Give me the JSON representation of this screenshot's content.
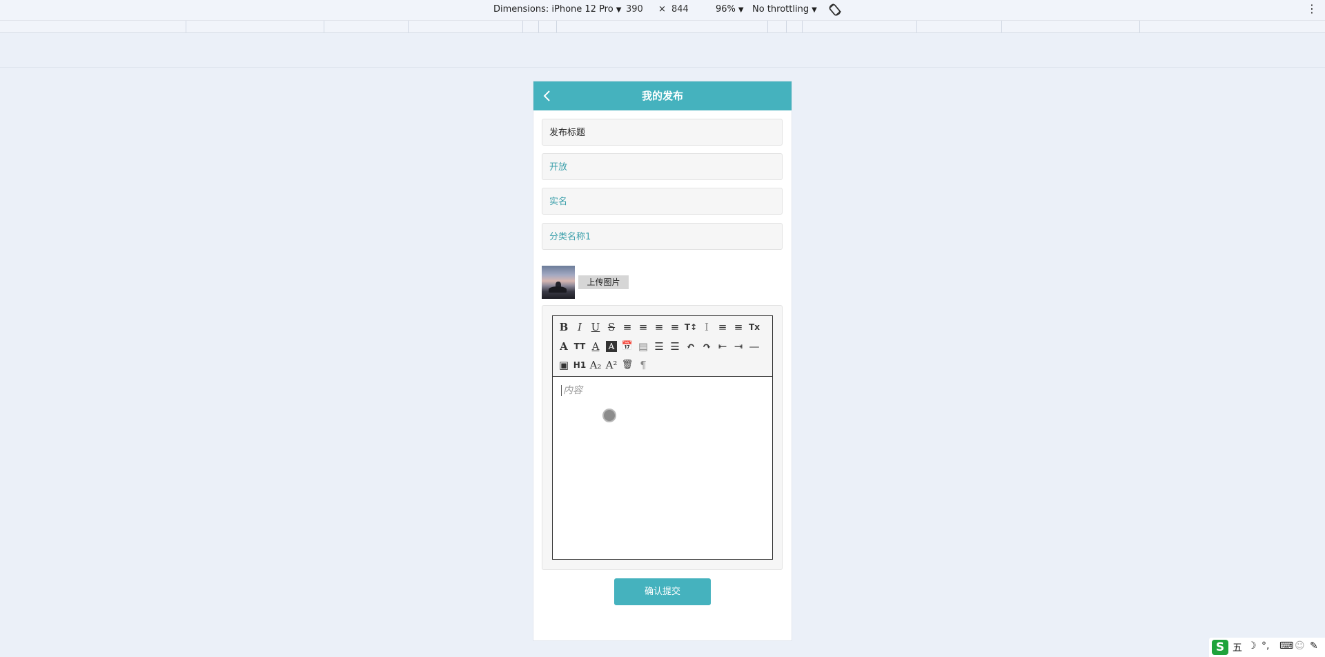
{
  "devtools": {
    "dimensions_label": "Dimensions: iPhone 12 Pro",
    "width": "390",
    "times": "×",
    "height": "844",
    "zoom": "96%",
    "throttling": "No throttling",
    "more_label": "⋮"
  },
  "header": {
    "title": "我的发布"
  },
  "form": {
    "title_value": "发布标题",
    "visibility_value": "开放",
    "identity_value": "实名",
    "category_value": "分类名称1",
    "upload_label": "上传图片"
  },
  "editor": {
    "toolbar_rows": [
      [
        "B",
        "I",
        "U",
        "S",
        "≡",
        "≡",
        "≡",
        "≡",
        "T↕",
        "I",
        "≡",
        "≡",
        "Tx"
      ],
      [
        "A",
        "TT",
        "A",
        "A",
        "📅",
        "▤",
        "☰",
        "☰",
        "↶",
        "↷",
        "⇤",
        "⇥",
        "—"
      ],
      [
        "▣",
        "H1",
        "A₂",
        "A²",
        "🗑",
        "¶"
      ]
    ],
    "content_placeholder": "内容"
  },
  "submit_label": "确认提交",
  "ime": {
    "logo": "S",
    "mode": "五",
    "moon": "☽",
    "punct": "°,",
    "keyboard": "⌨",
    "user": "☺",
    "settings": "✎"
  },
  "colors": {
    "accent": "#45b2be",
    "page_bg": "#ebf0f8"
  }
}
